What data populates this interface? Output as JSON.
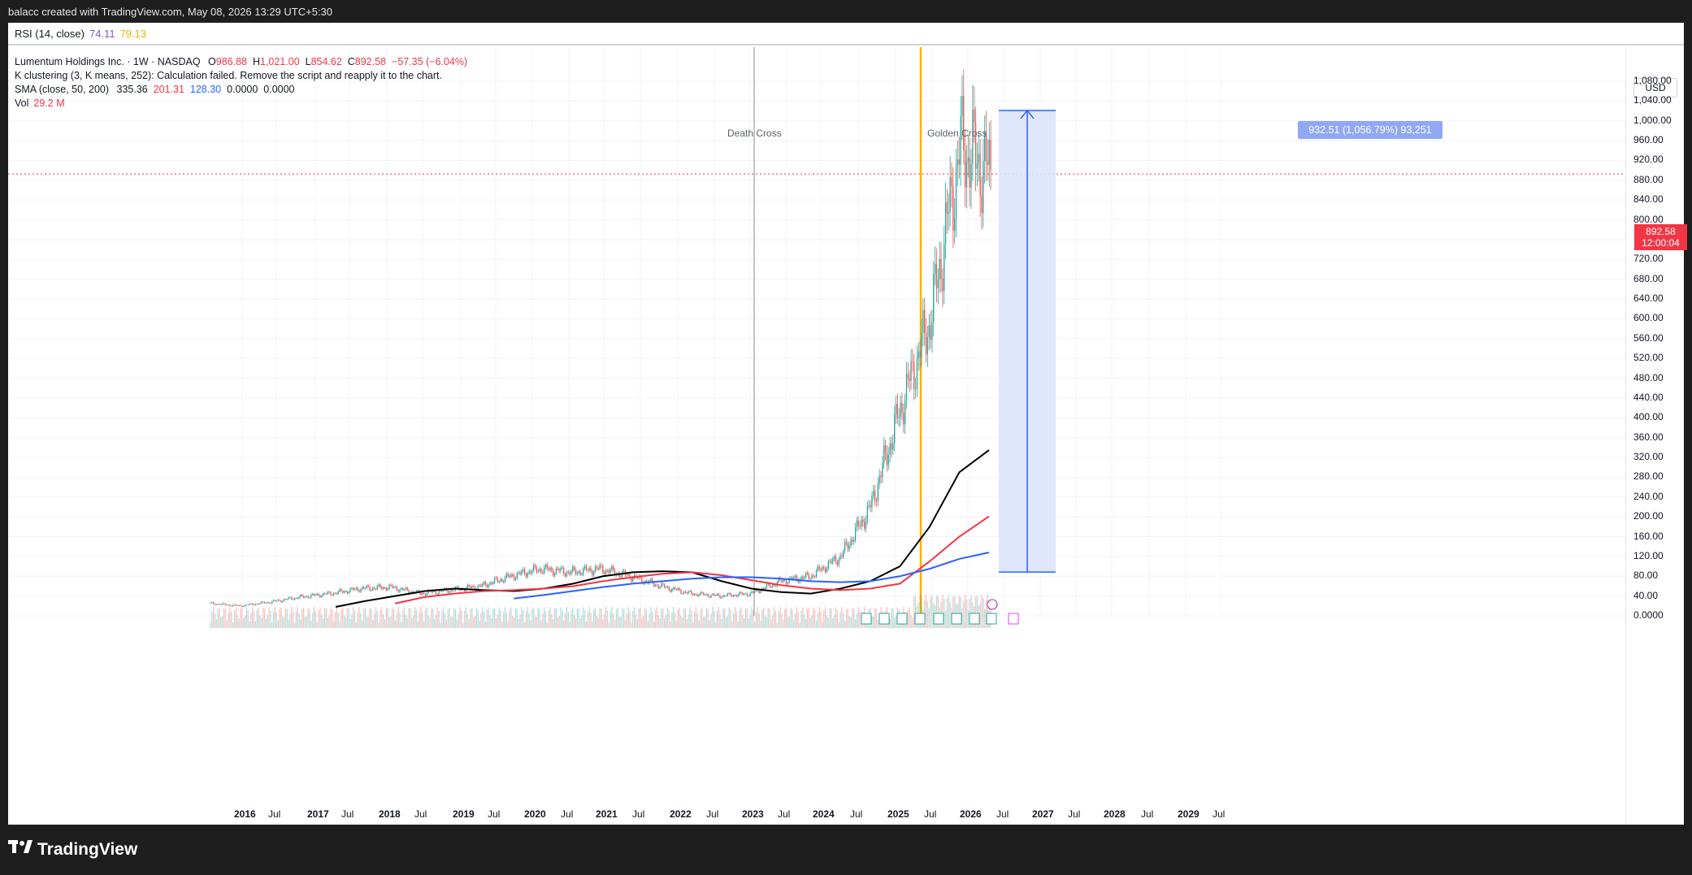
{
  "top_bar": {
    "text": "balacc created with TradingView.com, May 08, 2026 13:29 UTC+5:30"
  },
  "rsi": {
    "label": "RSI (14, close)",
    "value1": "74.11",
    "value2": "79.13"
  },
  "legend": {
    "symbol": "Lumentum Holdings Inc. · 1W · NASDAQ",
    "o_label": "O",
    "o_value": "986.88",
    "h_label": "H",
    "h_value": "1,021.00",
    "l_label": "L",
    "l_value": "854.62",
    "c_label": "C",
    "c_value": "892.58",
    "change": "−57.35 (−6.04%)",
    "kclust": "K clustering (3, K means, 252): Calculation failed. Remove the script and reapply it to the chart.",
    "sma_label": "SMA (close, 50, 200)",
    "sma_v1": "335.36",
    "sma_v2": "201.31",
    "sma_v3": "128.30",
    "sma_v4": "0.0000",
    "sma_v5": "0.0000",
    "vol_label": "Vol",
    "vol_value": "29.2 M"
  },
  "price_axis": {
    "currency": "USD",
    "ticks": [
      "1,080.00",
      "1,040.00",
      "1,000.00",
      "960.00",
      "920.00",
      "880.00",
      "840.00",
      "800.00",
      "760.00",
      "720.00",
      "680.00",
      "640.00",
      "600.00",
      "560.00",
      "520.00",
      "480.00",
      "440.00",
      "400.00",
      "360.00",
      "320.00",
      "280.00",
      "240.00",
      "200.00",
      "160.00",
      "120.00",
      "80.00",
      "40.00",
      "0.0000"
    ],
    "last_price": "892.58",
    "countdown": "12:00:04"
  },
  "time_axis": {
    "labels": [
      "2016",
      "Jul",
      "2017",
      "Jul",
      "2018",
      "Jul",
      "2019",
      "Jul",
      "2020",
      "Jul",
      "2021",
      "Jul",
      "2022",
      "Jul",
      "2023",
      "Jul",
      "2024",
      "Jul",
      "2025",
      "Jul",
      "2026",
      "Jul",
      "2027",
      "Jul",
      "2028",
      "Jul",
      "2029",
      "Jul"
    ]
  },
  "annotations": {
    "death_cross": "Death Cross",
    "golden_cross": "Golden Cross",
    "measure": "932.51 (1,056.79%) 93,251"
  },
  "brand": {
    "name": "TradingView"
  },
  "colors": {
    "up": "#26a69a",
    "down": "#ef5350",
    "sma50": "#000000",
    "sma200_red": "#f23645",
    "sma_blue": "#2962ff",
    "golden_line": "#f5b400",
    "measure_fill": "#dbe3fd",
    "measure_line": "#2962ff"
  },
  "chart_data": {
    "type": "candlestick",
    "series": [
      {
        "name": "price",
        "x": [
          "2015-10",
          "2016-01",
          "2016-07",
          "2017-01",
          "2017-07",
          "2018-01",
          "2018-07",
          "2019-01",
          "2019-07",
          "2020-01",
          "2020-07",
          "2021-01",
          "2021-07",
          "2022-01",
          "2022-07",
          "2023-01",
          "2023-07",
          "2024-01",
          "2024-07",
          "2025-01",
          "2025-04",
          "2025-07",
          "2025-10",
          "2026-01",
          "2026-03",
          "2026-04",
          "2026-05"
        ],
        "values": [
          25,
          20,
          28,
          38,
          45,
          55,
          58,
          45,
          52,
          60,
          80,
          95,
          88,
          95,
          80,
          60,
          45,
          40,
          45,
          70,
          80,
          120,
          220,
          420,
          600,
          950,
          892.58
        ]
      },
      {
        "name": "SMA 50",
        "values": [
          null,
          null,
          18,
          30,
          40,
          50,
          55,
          52,
          50,
          55,
          65,
          80,
          88,
          90,
          88,
          70,
          55,
          48,
          45,
          55,
          70,
          100,
          180,
          290,
          335
        ]
      },
      {
        "name": "SMA 200 (red)",
        "values": [
          null,
          null,
          null,
          null,
          25,
          38,
          45,
          50,
          52,
          55,
          60,
          70,
          78,
          85,
          88,
          82,
          72,
          62,
          55,
          52,
          55,
          65,
          110,
          160,
          201
        ]
      },
      {
        "name": "SMA (blue)",
        "values": [
          null,
          null,
          null,
          null,
          null,
          null,
          null,
          null,
          35,
          42,
          50,
          58,
          65,
          70,
          75,
          78,
          78,
          75,
          70,
          68,
          70,
          80,
          95,
          115,
          128
        ]
      }
    ],
    "ylim": [
      0,
      1080
    ]
  }
}
